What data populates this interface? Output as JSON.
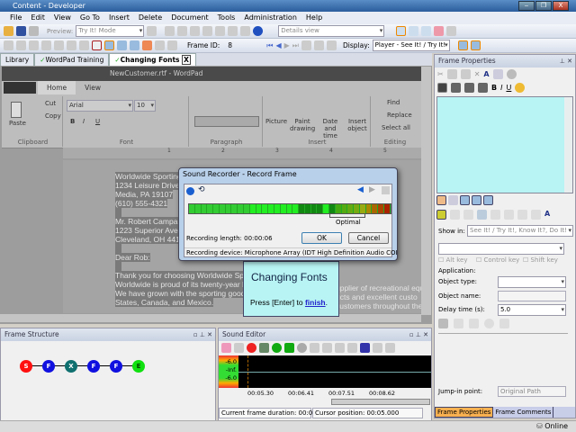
{
  "window": {
    "title": "Content - Developer",
    "minimize": "‒",
    "maximize": "❐",
    "close": "X"
  },
  "menu": [
    "File",
    "Edit",
    "View",
    "Go To",
    "Insert",
    "Delete",
    "Document",
    "Tools",
    "Administration",
    "Help"
  ],
  "toolbar": {
    "preview_label": "Preview:",
    "preview_mode": "Try It! Mode",
    "view_select": "Details view",
    "frame_id_label": "Frame ID:",
    "frame_id": "8",
    "display_label": "Display:",
    "display_value": "Player - See It! / Try It!"
  },
  "tabs": [
    {
      "label": "Library"
    },
    {
      "label": "WordPad Training"
    },
    {
      "label": "Changing Fonts",
      "close": "X"
    }
  ],
  "wordpad": {
    "title": "NewCustomer.rtf - WordPad",
    "ribbon_tabs": [
      "Home",
      "View"
    ],
    "clipboard": {
      "paste": "Paste",
      "cut": "Cut",
      "copy": "Copy",
      "label": "Clipboard"
    },
    "font": {
      "name": "Arial",
      "size": "10",
      "label": "Font",
      "bold": "B",
      "italic": "I",
      "underline": "U"
    },
    "paragraph": {
      "label": "Paragraph"
    },
    "insert": {
      "picture": "Picture",
      "paint": "Paint drawing",
      "datetime": "Date and time",
      "object": "Insert object",
      "label": "Insert"
    },
    "editing": {
      "find": "Find",
      "replace": "Replace",
      "select_all": "Select all",
      "label": "Editing"
    },
    "ruler": [
      "1",
      "2",
      "3",
      "4",
      "5"
    ],
    "doc_lines": [
      "Worldwide Sporting",
      "1234 Leisure Drive",
      "Media, PA 19107",
      "(610) 555-4321",
      "",
      "Mr. Robert Campar",
      "1223 Superior Aven",
      "Cleveland, OH  441",
      "",
      "Dear Rob:",
      "",
      "Thank you for choosing Worldwide Spo",
      "Worldwide is proud of its twenty-year h",
      "We have grown with the sporting goods",
      "States, Canada, and Mexico."
    ],
    "doc_right": [
      "upplier of recreational equ",
      "ucts and excellent custo",
      "customers throughout the"
    ]
  },
  "dialog": {
    "title": "Sound Recorder - Record Frame",
    "optimal": "Optimal",
    "length": "Recording length: 00:00:06",
    "ok": "OK",
    "cancel": "Cancel",
    "device": "Recording device: Microphone Array (IDT High Definition Audio COI"
  },
  "callout": {
    "title": "Changing Fonts",
    "text_prefix": "Press [Enter] to ",
    "link": "finish",
    "suffix": "."
  },
  "frame_structure": {
    "title": "Frame Structure",
    "nodes": [
      {
        "label": "S",
        "color": "#ff1010"
      },
      {
        "label": "F",
        "color": "#1010e0"
      },
      {
        "label": "X",
        "color": "#107070"
      },
      {
        "label": "F",
        "color": "#1010e0"
      },
      {
        "label": "F",
        "color": "#1010e0"
      },
      {
        "label": "E",
        "color": "#10e010"
      }
    ]
  },
  "sound_editor": {
    "title": "Sound Editor",
    "scale": [
      "-6.0",
      "-Inf.",
      "-6.0"
    ],
    "times": [
      "00:05.30",
      "00:06.41",
      "00:07.51",
      "00:08.62"
    ],
    "duration": "Current frame duration: 00:05",
    "cursor": "Cursor position: 00:05.000"
  },
  "frame_properties": {
    "title": "Frame Properties",
    "show_in_label": "Show in:",
    "show_in": "See It! / Try It!, Know It?, Do It!",
    "alt": "Alt key",
    "ctrl": "Control key",
    "shift": "Shift key",
    "application": "Application:",
    "object_type": "Object type:",
    "object_name": "Object name:",
    "delay_label": "Delay time (s):",
    "delay": "5.0",
    "jump_label": "Jump-in point:",
    "jump": "Original Path",
    "tabs": [
      "Frame Properties",
      "Frame Comments"
    ]
  },
  "status": {
    "online": "Online"
  }
}
